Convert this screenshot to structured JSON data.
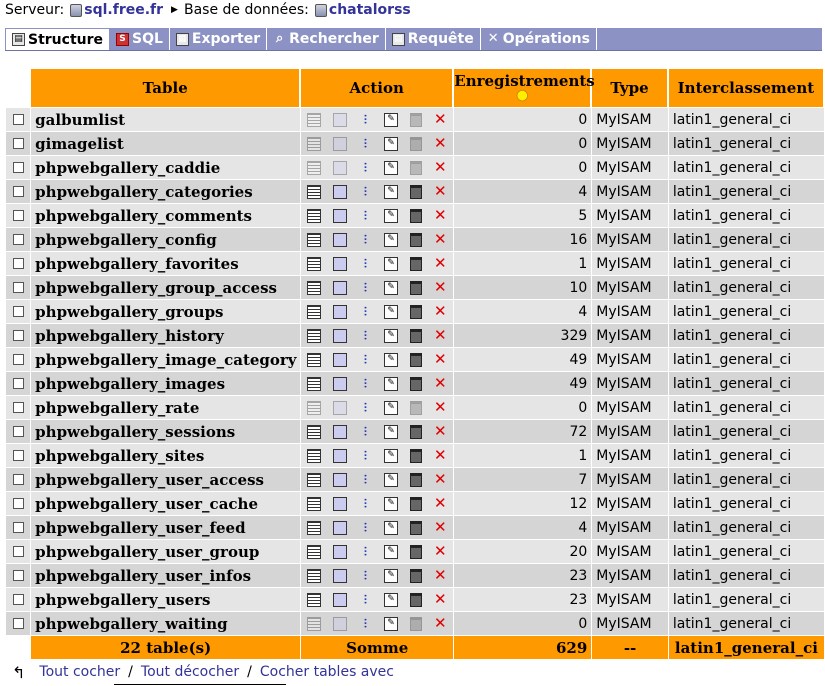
{
  "breadcrumb": {
    "server_label": "Serveur:",
    "server": "sql.free.fr",
    "db_label": "Base de données:",
    "db": "chatalorss"
  },
  "tabs": [
    {
      "label": "Structure",
      "icon": "structure-icon",
      "active": true
    },
    {
      "label": "SQL",
      "icon": "sql-icon",
      "active": false
    },
    {
      "label": "Exporter",
      "icon": "export-icon",
      "active": false
    },
    {
      "label": "Rechercher",
      "icon": "search-icon",
      "active": false
    },
    {
      "label": "Requête",
      "icon": "query-icon",
      "active": false
    },
    {
      "label": "Opérations",
      "icon": "operations-icon",
      "active": false
    }
  ],
  "table": {
    "headers": {
      "table": "Table",
      "action": "Action",
      "records": "Enregistrements",
      "type": "Type",
      "collation": "Interclassement"
    },
    "rows": [
      {
        "name": "galbumlist",
        "records": "0",
        "type": "MyISAM",
        "collation": "latin1_general_ci"
      },
      {
        "name": "gimagelist",
        "records": "0",
        "type": "MyISAM",
        "collation": "latin1_general_ci"
      },
      {
        "name": "phpwebgallery_caddie",
        "records": "0",
        "type": "MyISAM",
        "collation": "latin1_general_ci"
      },
      {
        "name": "phpwebgallery_categories",
        "records": "4",
        "type": "MyISAM",
        "collation": "latin1_general_ci"
      },
      {
        "name": "phpwebgallery_comments",
        "records": "5",
        "type": "MyISAM",
        "collation": "latin1_general_ci"
      },
      {
        "name": "phpwebgallery_config",
        "records": "16",
        "type": "MyISAM",
        "collation": "latin1_general_ci"
      },
      {
        "name": "phpwebgallery_favorites",
        "records": "1",
        "type": "MyISAM",
        "collation": "latin1_general_ci"
      },
      {
        "name": "phpwebgallery_group_access",
        "records": "10",
        "type": "MyISAM",
        "collation": "latin1_general_ci"
      },
      {
        "name": "phpwebgallery_groups",
        "records": "4",
        "type": "MyISAM",
        "collation": "latin1_general_ci"
      },
      {
        "name": "phpwebgallery_history",
        "records": "329",
        "type": "MyISAM",
        "collation": "latin1_general_ci"
      },
      {
        "name": "phpwebgallery_image_category",
        "records": "49",
        "type": "MyISAM",
        "collation": "latin1_general_ci"
      },
      {
        "name": "phpwebgallery_images",
        "records": "49",
        "type": "MyISAM",
        "collation": "latin1_general_ci"
      },
      {
        "name": "phpwebgallery_rate",
        "records": "0",
        "type": "MyISAM",
        "collation": "latin1_general_ci"
      },
      {
        "name": "phpwebgallery_sessions",
        "records": "72",
        "type": "MyISAM",
        "collation": "latin1_general_ci"
      },
      {
        "name": "phpwebgallery_sites",
        "records": "1",
        "type": "MyISAM",
        "collation": "latin1_general_ci"
      },
      {
        "name": "phpwebgallery_user_access",
        "records": "7",
        "type": "MyISAM",
        "collation": "latin1_general_ci"
      },
      {
        "name": "phpwebgallery_user_cache",
        "records": "12",
        "type": "MyISAM",
        "collation": "latin1_general_ci"
      },
      {
        "name": "phpwebgallery_user_feed",
        "records": "4",
        "type": "MyISAM",
        "collation": "latin1_general_ci"
      },
      {
        "name": "phpwebgallery_user_group",
        "records": "20",
        "type": "MyISAM",
        "collation": "latin1_general_ci"
      },
      {
        "name": "phpwebgallery_user_infos",
        "records": "23",
        "type": "MyISAM",
        "collation": "latin1_general_ci"
      },
      {
        "name": "phpwebgallery_users",
        "records": "23",
        "type": "MyISAM",
        "collation": "latin1_general_ci"
      },
      {
        "name": "phpwebgallery_waiting",
        "records": "0",
        "type": "MyISAM",
        "collation": "latin1_general_ci"
      }
    ],
    "footer": {
      "count": "22 table(s)",
      "sum_label": "Somme",
      "total": "629",
      "type": "--",
      "collation": "latin1_general_ci"
    }
  },
  "bottom": {
    "check_all": "Tout cocher",
    "uncheck_all": "Tout décocher",
    "check_overhead": "Cocher tables avec"
  },
  "colors": {
    "header_bg": "#ff9900",
    "tab_bar": "#8c93c4",
    "row_odd": "#e5e5e5",
    "row_even": "#d5d5d5",
    "link": "#333399"
  }
}
